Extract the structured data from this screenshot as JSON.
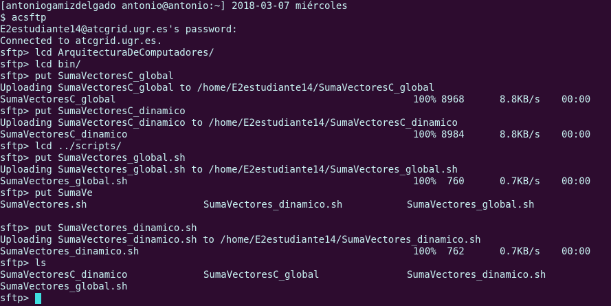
{
  "terminal": {
    "lines": [
      {
        "type": "text",
        "text": "[antoniogamizdelgado antonio@antonio:~] 2018-03-07 miércoles"
      },
      {
        "type": "text",
        "text": "$ acsftp"
      },
      {
        "type": "text",
        "text": "E2estudiante14@atcgrid.ugr.es's password:"
      },
      {
        "type": "text",
        "text": "Connected to atcgrid.ugr.es."
      },
      {
        "type": "text",
        "text": "sftp> lcd ArquitecturaDeComputadores/"
      },
      {
        "type": "text",
        "text": "sftp> lcd bin/"
      },
      {
        "type": "text",
        "text": "sftp> put SumaVectoresC_global"
      },
      {
        "type": "text",
        "text": "Uploading SumaVectoresC_global to /home/E2estudiante14/SumaVectoresC_global"
      },
      {
        "type": "transfer",
        "file": "SumaVectoresC_global",
        "percent": "100%",
        "size": "8968",
        "rate": "8.8KB/s",
        "time": "00:00"
      },
      {
        "type": "text",
        "text": "sftp> put SumaVectoresC_dinamico"
      },
      {
        "type": "text",
        "text": "Uploading SumaVectoresC_dinamico to /home/E2estudiante14/SumaVectoresC_dinamico"
      },
      {
        "type": "transfer",
        "file": "SumaVectoresC_dinamico",
        "percent": "100%",
        "size": "8984",
        "rate": "8.8KB/s",
        "time": "00:00"
      },
      {
        "type": "text",
        "text": "sftp> lcd ../scripts/"
      },
      {
        "type": "text",
        "text": "sftp> put SumaVectores_global.sh"
      },
      {
        "type": "text",
        "text": "Uploading SumaVectores_global.sh to /home/E2estudiante14/SumaVectores_global.sh"
      },
      {
        "type": "transfer",
        "file": "SumaVectores_global.sh",
        "percent": "100%",
        "size": " 760",
        "rate": "0.7KB/s",
        "time": "00:00"
      },
      {
        "type": "text",
        "text": "sftp> put SumaVe"
      },
      {
        "type": "columns",
        "items": [
          "SumaVectores.sh",
          "SumaVectores_dinamico.sh",
          "SumaVectores_global.sh"
        ]
      },
      {
        "type": "text",
        "text": ""
      },
      {
        "type": "text",
        "text": "sftp> put SumaVectores_dinamico.sh"
      },
      {
        "type": "text",
        "text": "Uploading SumaVectores_dinamico.sh to /home/E2estudiante14/SumaVectores_dinamico.sh"
      },
      {
        "type": "transfer",
        "file": "SumaVectores_dinamico.sh",
        "percent": "100%",
        "size": " 762",
        "rate": "0.7KB/s",
        "time": "00:00"
      },
      {
        "type": "text",
        "text": "sftp> ls"
      },
      {
        "type": "columns",
        "items": [
          "SumaVectoresC_dinamico",
          "SumaVectoresC_global",
          "SumaVectores_dinamico.sh"
        ]
      },
      {
        "type": "text",
        "text": "SumaVectores_global.sh"
      },
      {
        "type": "prompt",
        "text": "sftp> "
      }
    ]
  }
}
